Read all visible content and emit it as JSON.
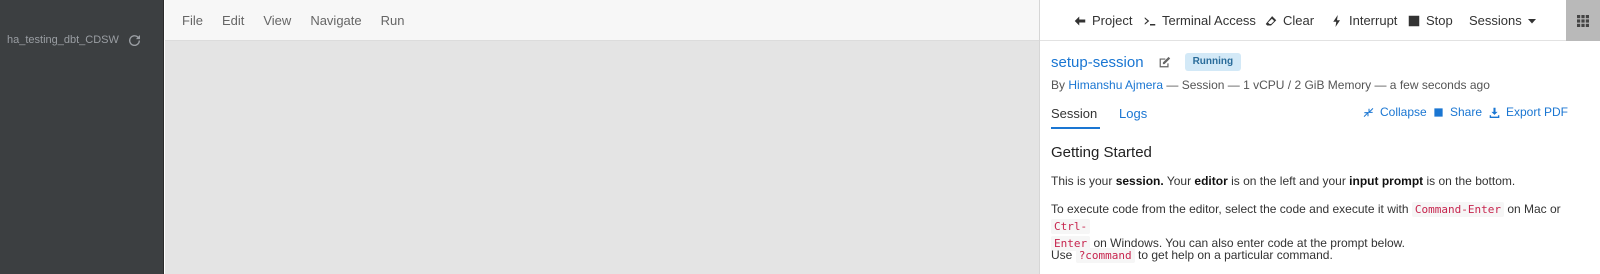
{
  "sidebar": {
    "project_name": "ha_testing_dbt_CDSW",
    "refresh_icon": "refresh-icon"
  },
  "menubar": {
    "items": [
      "File",
      "Edit",
      "View",
      "Navigate",
      "Run"
    ]
  },
  "toolbar": {
    "project": "Project",
    "terminal": "Terminal Access",
    "clear": "Clear",
    "interrupt": "Interrupt",
    "stop": "Stop",
    "sessions": "Sessions"
  },
  "session": {
    "title": "setup-session",
    "status": "Running",
    "by": "By",
    "author": "Himanshu Ajmera",
    "meta_rest": "— Session — 1 vCPU / 2 GiB Memory — a few seconds ago"
  },
  "tabs": {
    "session": "Session",
    "logs": "Logs"
  },
  "actions": {
    "collapse": "Collapse",
    "share": "Share",
    "export": "Export PDF"
  },
  "doc": {
    "heading": "Getting Started",
    "p1": {
      "a": "This is your ",
      "b": "session.",
      "c": " Your ",
      "d": "editor",
      "e": " is on the left and your ",
      "f": "input prompt",
      "g": " is on the bottom."
    },
    "p2": {
      "a": "To execute code from the editor, select the code and execute it with ",
      "code1": "Command-Enter",
      "b": " on Mac or ",
      "code2a": "Ctrl-",
      "code2b": "Enter",
      "c": " on Windows. You can also enter code at the prompt below."
    },
    "p3": {
      "a": "Use ",
      "code": "?command",
      "b": " to get help on a particular command."
    }
  },
  "colors": {
    "accent": "#1a76d2",
    "sidebar_bg": "#3c3f41",
    "badge_bg": "#d3e9f7"
  }
}
